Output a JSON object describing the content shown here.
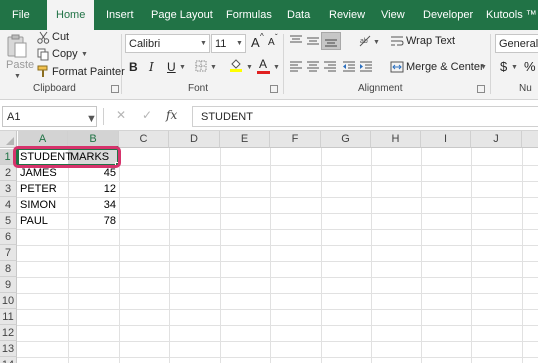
{
  "ribbon_tabs": [
    "File",
    "Home",
    "Insert",
    "Page Layout",
    "Formulas",
    "Data",
    "Review",
    "View",
    "Developer",
    "Kutools ™"
  ],
  "active_tab": "Home",
  "clipboard": {
    "paste_label": "Paste",
    "cut_label": "Cut",
    "copy_label": "Copy",
    "format_painter_label": "Format Painter",
    "group_label": "Clipboard"
  },
  "font": {
    "font_name": "Calibri",
    "font_size": "11",
    "bold": "B",
    "italic": "I",
    "underline": "U",
    "grow_font": "A",
    "shrink_font": "A",
    "font_color_glyph": "A",
    "group_label": "Font"
  },
  "alignment": {
    "wrap_text_label": "Wrap Text",
    "merge_center_label": "Merge & Center",
    "group_label": "Alignment"
  },
  "number": {
    "format_value": "General",
    "currency_symbol": "$",
    "percent_symbol": "%",
    "group_label": "Nu"
  },
  "formula_bar": {
    "name_box": "A1",
    "fx_label": "fx",
    "cancel_glyph": "✕",
    "enter_glyph": "✓",
    "content": "STUDENT"
  },
  "sheet": {
    "columns": [
      "A",
      "B",
      "C",
      "D",
      "E",
      "F",
      "G",
      "H",
      "I",
      "J"
    ],
    "rows": [
      "1",
      "2",
      "3",
      "4",
      "5",
      "6",
      "7",
      "8",
      "9",
      "10",
      "11",
      "12",
      "13",
      "14"
    ],
    "headers": [
      "STUDENT",
      "MARKS"
    ],
    "data": [
      [
        "JAMES",
        "45"
      ],
      [
        "PETER",
        "12"
      ],
      [
        "SIMON",
        "34"
      ],
      [
        "PAUL",
        "78"
      ]
    ]
  },
  "colors": {
    "accent": "#217346",
    "highlight": "#d6336c",
    "font_color_bar": "#e02020",
    "fill_color_bar": "#ffff00"
  },
  "icons": [
    "paste-icon",
    "scissors-icon",
    "copy-icon",
    "format-painter-icon",
    "borders-icon",
    "fill-color-icon",
    "font-color-icon",
    "wrap-text-icon",
    "merge-center-icon",
    "orientation-icon",
    "align-top-icon",
    "align-middle-icon",
    "align-bottom-icon",
    "align-left-icon",
    "align-center-icon",
    "align-right-icon",
    "decrease-indent-icon",
    "increase-indent-icon",
    "dialog-launcher-icon"
  ]
}
